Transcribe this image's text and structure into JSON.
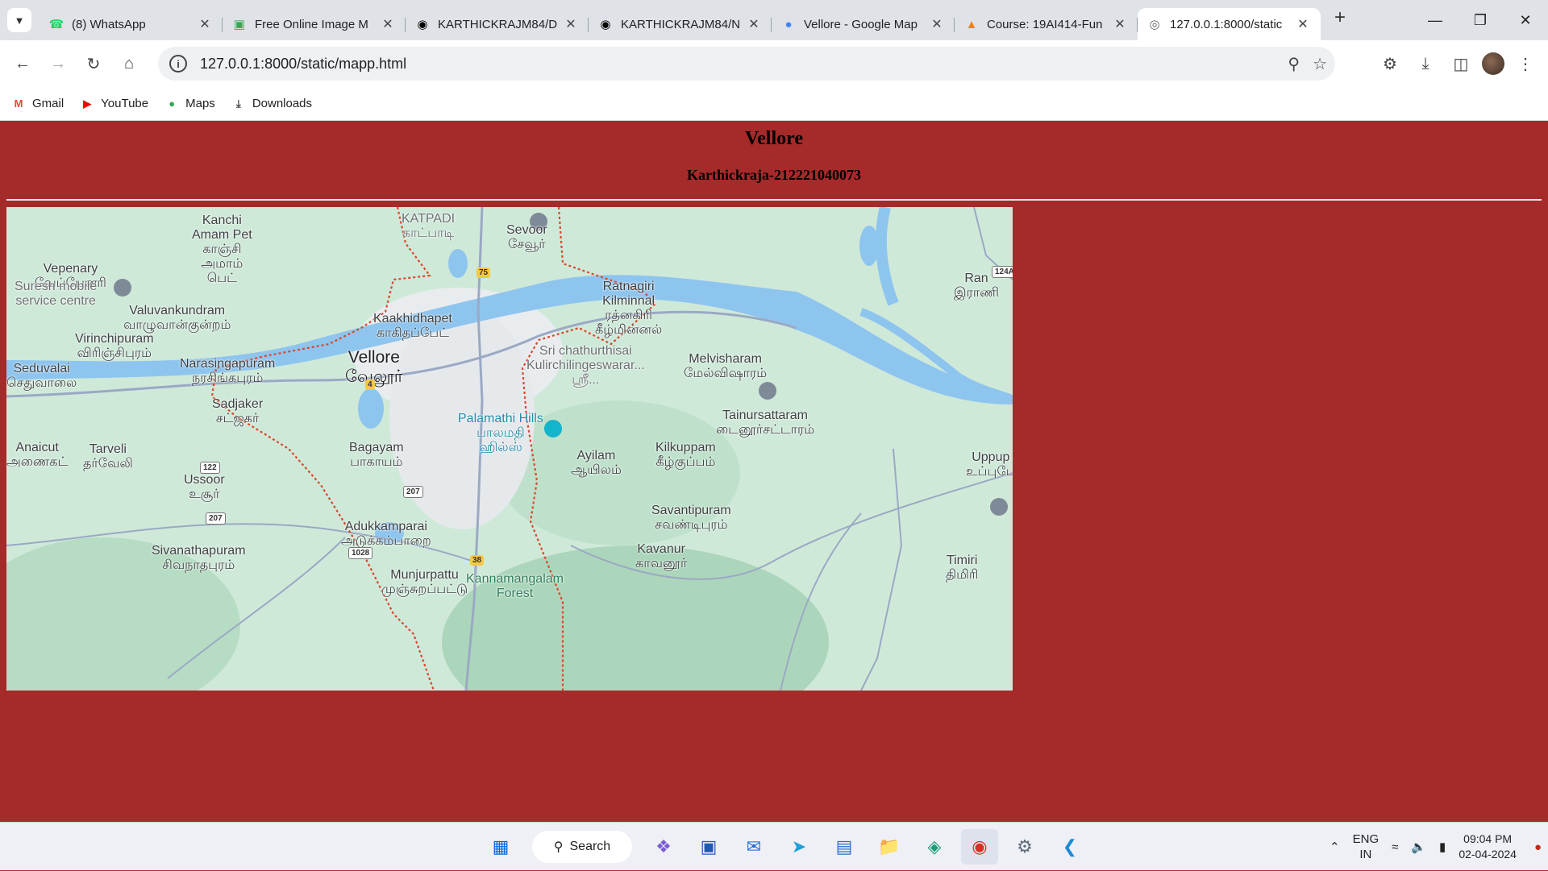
{
  "browser": {
    "tabs": [
      {
        "title": "(8) WhatsApp",
        "icon": "whatsapp-icon",
        "color": "#25d366"
      },
      {
        "title": "Free Online Image M",
        "icon": "image-tool-icon",
        "color": "#34a853"
      },
      {
        "title": "KARTHICKRAJM84/D",
        "icon": "github-icon",
        "color": "#000000"
      },
      {
        "title": "KARTHICKRAJM84/N",
        "icon": "github-icon",
        "color": "#000000"
      },
      {
        "title": "Vellore - Google Map",
        "icon": "google-maps-icon",
        "color": "#4285f4"
      },
      {
        "title": "Course: 19AI414-Fun",
        "icon": "moodle-icon",
        "color": "#f98012"
      },
      {
        "title": "127.0.0.1:8000/static",
        "icon": "globe-icon",
        "color": "#5f6368",
        "active": true
      }
    ],
    "url": "127.0.0.1:8000/static/mapp.html",
    "bookmarks": [
      {
        "label": "Gmail",
        "icon": "gmail-icon"
      },
      {
        "label": "YouTube",
        "icon": "youtube-icon"
      },
      {
        "label": "Maps",
        "icon": "maps-icon"
      },
      {
        "label": "Downloads",
        "icon": "download-icon"
      }
    ]
  },
  "page": {
    "title": "Vellore",
    "subtitle": "Karthickraja-212221040073",
    "background": "#a52a2a"
  },
  "map": {
    "places": [
      {
        "name": "Kanchi\nAmam Pet",
        "local": "காஞ்சி\nஅமாம்\nபெட்"
      },
      {
        "name": "KATPADI",
        "local": "காட்பாடி"
      },
      {
        "name": "Sevoor",
        "local": "சேவூர்"
      },
      {
        "name": "Vepenary",
        "local": "வேப்பேனரி"
      },
      {
        "name": "Suresh mobile\nservice centre",
        "local": ""
      },
      {
        "name": "Valuvankundram",
        "local": "வாழுவான்குன்றம்"
      },
      {
        "name": "Kaakhidhapet",
        "local": "காகிதப்பேட்"
      },
      {
        "name": "Ratnagiri\nKilminnal",
        "local": "ரத்னகிரி\nகீழ்மின்னல்"
      },
      {
        "name": "Virinchipuram",
        "local": "விரிஞ்சிபுரம்"
      },
      {
        "name": "Vellore",
        "local": "வேலூர்"
      },
      {
        "name": "Sri chathurthisai\nKulirchilingeswarar...",
        "local": "ஸ்ரீ..."
      },
      {
        "name": "Melvisharam",
        "local": "மேல்விஷாரம்"
      },
      {
        "name": "Seduvalai",
        "local": "செதுவாலை"
      },
      {
        "name": "Narasingapuram",
        "local": "நரசிங்கபுரம்"
      },
      {
        "name": "Sadjaker",
        "local": "சட்ஜகர்"
      },
      {
        "name": "Palamathi Hills",
        "local": "பாலமதி\nஹில்ஸ்"
      },
      {
        "name": "Tainursattaram",
        "local": "டைனூர்சட்டாரம்"
      },
      {
        "name": "Anaicut",
        "local": "அணைகட்"
      },
      {
        "name": "Tarveli",
        "local": "தர்வேலி"
      },
      {
        "name": "Bagayam",
        "local": "பாகாயம்"
      },
      {
        "name": "Ayilam",
        "local": "ஆயிலம்"
      },
      {
        "name": "Kilkuppam",
        "local": "கீழ்குப்பம்"
      },
      {
        "name": "Uppup",
        "local": "உப்புபே"
      },
      {
        "name": "Ussoor",
        "local": "உசூர்"
      },
      {
        "name": "Savantipuram",
        "local": "சவண்டிபுரம்"
      },
      {
        "name": "Adukkamparai",
        "local": "அடுக்கம்பாறை"
      },
      {
        "name": "Sivanathapuram",
        "local": "சிவநாதபுரம்"
      },
      {
        "name": "Kavanur",
        "local": "காவனூர்"
      },
      {
        "name": "Munjurpattu",
        "local": "முஞ்சுறப்பட்டு"
      },
      {
        "name": "Kannamangalam\nForest",
        "local": ""
      },
      {
        "name": "Timiri",
        "local": "திமிரி"
      },
      {
        "name": "Ran",
        "local": "இராணி"
      }
    ],
    "road_shields": [
      "75",
      "4",
      "122",
      "207",
      "207",
      "1028",
      "38",
      "124A"
    ]
  },
  "taskbar": {
    "search_label": "Search",
    "apps": [
      "windows-start-icon",
      "copilot-icon",
      "store-icon",
      "mail-icon",
      "telegram-icon",
      "notepad-icon",
      "file-explorer-icon",
      "edge-icon",
      "chrome-icon",
      "settings-icon",
      "vscode-icon"
    ],
    "lang": "ENG",
    "region": "IN",
    "time": "09:04 PM",
    "date": "02-04-2024"
  }
}
